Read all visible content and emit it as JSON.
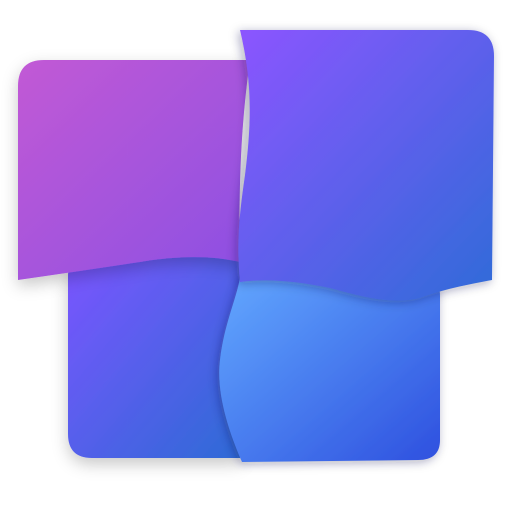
{
  "icon": {
    "name": "app-logo-icon",
    "colors": {
      "background": "#ffffff",
      "top_left_tile": [
        "#c05ad6",
        "#8a4fe0"
      ],
      "top_right_tile": [
        "#8a55ff",
        "#2f6ad8"
      ],
      "bottom_left_tile": [
        "#7a55ff",
        "#2f6ad8"
      ],
      "bottom_right_tile": [
        "#5fa6ff",
        "#2f55e0"
      ]
    }
  }
}
